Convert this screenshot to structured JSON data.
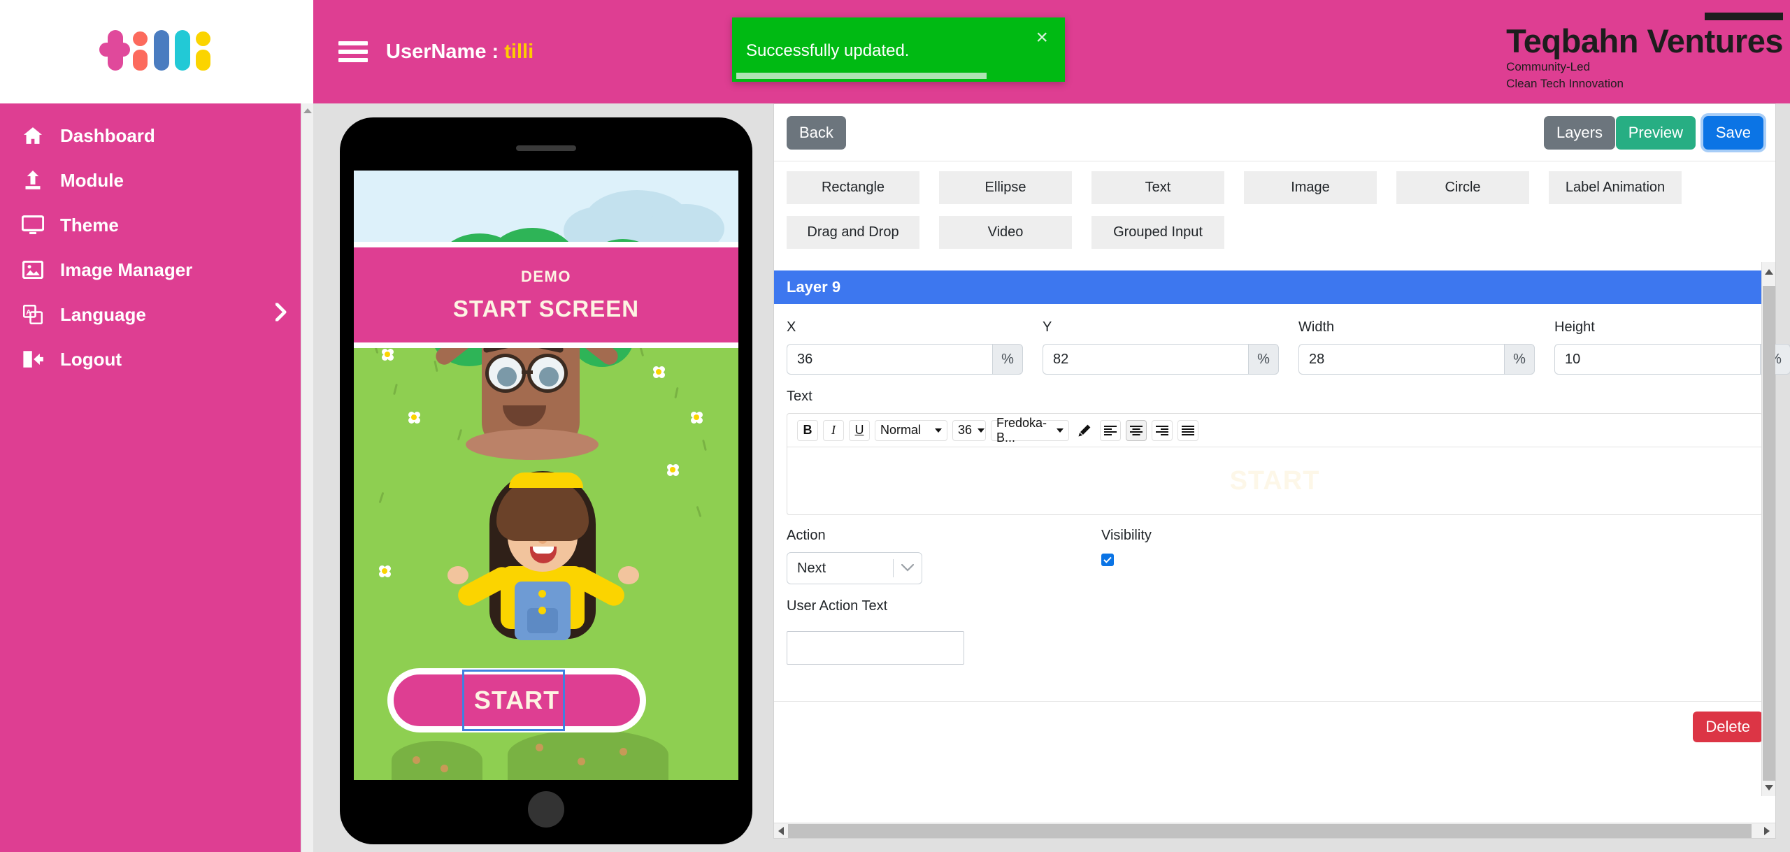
{
  "brand": {
    "logo_text": "tilli",
    "company_name": "Teqbahn Ventures",
    "tagline_line1": "Community-Led",
    "tagline_line2": "Clean Tech Innovation",
    "colors": {
      "pink": "#de3e92",
      "primary_blue": "#0b74e5",
      "layer_blue": "#3d77ef",
      "success_green": "#00ba13",
      "danger_red": "#dc3545",
      "preview_green": "#27ae83",
      "gray": "#6c757d"
    }
  },
  "header": {
    "username_label": "UserName : ",
    "username_value": "tilli",
    "menu_icon": "hamburger-icon"
  },
  "toast": {
    "message": "Successfully updated.",
    "close_label": "×",
    "progress_percent": 75
  },
  "sidebar": {
    "items": [
      {
        "label": "Dashboard",
        "icon": "home-icon",
        "has_submenu": false
      },
      {
        "label": "Module",
        "icon": "upload-icon",
        "has_submenu": false
      },
      {
        "label": "Theme",
        "icon": "monitor-icon",
        "has_submenu": false
      },
      {
        "label": "Image Manager",
        "icon": "image-icon",
        "has_submenu": false
      },
      {
        "label": "Language",
        "icon": "translate-icon",
        "has_submenu": true
      },
      {
        "label": "Logout",
        "icon": "logout-icon",
        "has_submenu": false
      }
    ]
  },
  "preview": {
    "banner_title": "DEMO",
    "banner_subtitle": "START SCREEN",
    "start_button_label": "START"
  },
  "editor": {
    "toolbar": {
      "back_label": "Back",
      "layers_label": "Layers",
      "preview_label": "Preview",
      "save_label": "Save"
    },
    "shape_tools": [
      "Rectangle",
      "Ellipse",
      "Text",
      "Image",
      "Circle",
      "Label Animation",
      "Drag and Drop",
      "Video",
      "Grouped Input"
    ],
    "layer_title": "Layer 9",
    "geometry": [
      {
        "label": "X",
        "value": "36",
        "unit": "%"
      },
      {
        "label": "Y",
        "value": "82",
        "unit": "%"
      },
      {
        "label": "Width",
        "value": "28",
        "unit": "%"
      },
      {
        "label": "Height",
        "value": "10",
        "unit": "%"
      }
    ],
    "text_section": {
      "label": "Text",
      "bold_label": "B",
      "italic_label": "I",
      "underline_label": "U",
      "style_value": "Normal",
      "size_value": "36",
      "font_value": "Fredoka-B...",
      "content": "START"
    },
    "action": {
      "label": "Action",
      "value": "Next"
    },
    "visibility": {
      "label": "Visibility",
      "checked": true
    },
    "user_action_text": {
      "label": "User Action Text",
      "value": "",
      "placeholder": ""
    },
    "delete_label": "Delete"
  }
}
